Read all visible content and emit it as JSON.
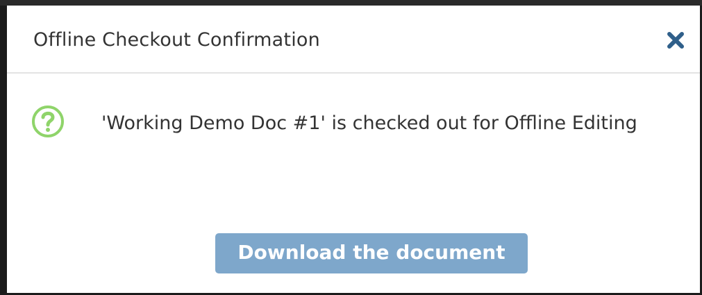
{
  "dialog": {
    "title": "Offline Checkout Confirmation",
    "close_icon": "close-icon",
    "message_icon": "question-icon",
    "message": "'Working Demo Doc #1' is checked out for Offline Editing",
    "download_label": "Download the document"
  },
  "colors": {
    "accent_button": "#7ea7cb",
    "close_icon": "#2f5f8a",
    "question_icon": "#8fd46a"
  }
}
